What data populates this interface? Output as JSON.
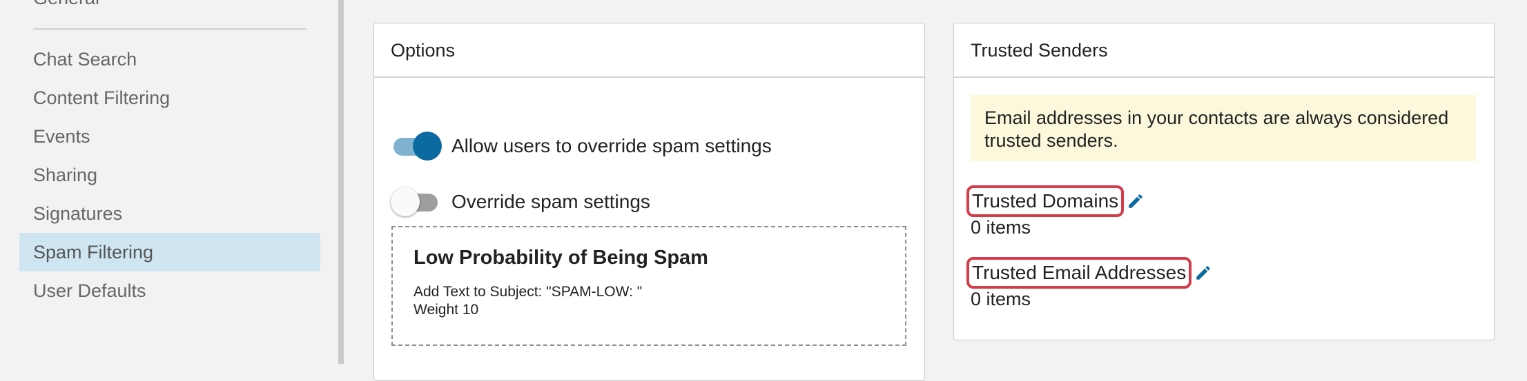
{
  "sidebar": {
    "heading": "General",
    "items": [
      {
        "label": "Chat Search"
      },
      {
        "label": "Content Filtering"
      },
      {
        "label": "Events"
      },
      {
        "label": "Sharing"
      },
      {
        "label": "Signatures"
      },
      {
        "label": "Spam Filtering",
        "active": true
      },
      {
        "label": "User Defaults"
      }
    ]
  },
  "options": {
    "title": "Options",
    "toggles": [
      {
        "label": "Allow users to override spam settings",
        "on": true
      },
      {
        "label": "Override spam settings",
        "on": false
      }
    ],
    "spam_rule": {
      "title": "Low Probability of Being Spam",
      "line1": "Add Text to Subject: \"SPAM-LOW: \"",
      "line2": "Weight 10"
    }
  },
  "trusted": {
    "title": "Trusted Senders",
    "notice": "Email addresses in your contacts are always considered trusted senders.",
    "domains": {
      "label": "Trusted Domains",
      "count": "0 items"
    },
    "emails": {
      "label": "Trusted Email Addresses",
      "count": "0 items"
    }
  },
  "colors": {
    "accent": "#0b6aa0",
    "active_item_bg": "#cfe6f2",
    "highlight_border": "#d33c4a",
    "notice_bg": "#fbf8dc"
  },
  "icons": {
    "edit": "pencil-icon"
  }
}
